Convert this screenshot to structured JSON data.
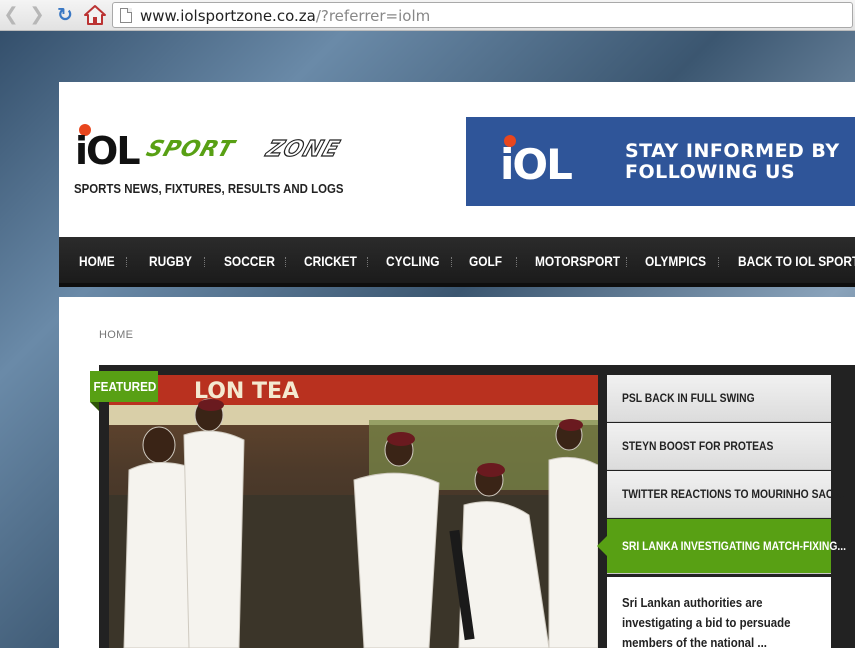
{
  "browser": {
    "url_host": "www.iolsportzone.co.za",
    "url_path": "/?referrer=iolm"
  },
  "header": {
    "logo_iol": "iOL",
    "logo_sportzone": "SPORTZONE",
    "tagline": "SPORTS NEWS, FIXTURES, RESULTS AND LOGS",
    "banner": {
      "logo": "iOL",
      "text": "STAY INFORMED BY\nFOLLOWING US",
      "color": "#2f5599"
    }
  },
  "nav": {
    "items": [
      "HOME",
      "RUGBY",
      "SOCCER",
      "CRICKET",
      "CYCLING",
      "GOLF",
      "MOTORSPORT",
      "OLYMPICS",
      "BACK TO IOL SPORT"
    ]
  },
  "content": {
    "breadcrumb": "HOME",
    "featured_label": "FEATURED",
    "photo_sign": "LON TEA",
    "side_items": [
      "PSL BACK IN FULL SWING",
      "STEYN BOOST FOR PROTEAS",
      "TWITTER REACTIONS TO MOURINHO SACKL...",
      "SRI LANKA INVESTIGATING MATCH-FIXING..."
    ],
    "active_index": 3,
    "excerpt": "Sri Lankan authorities are investigating a bid to persuade members of the national ...",
    "accent_color": "#58a014"
  }
}
